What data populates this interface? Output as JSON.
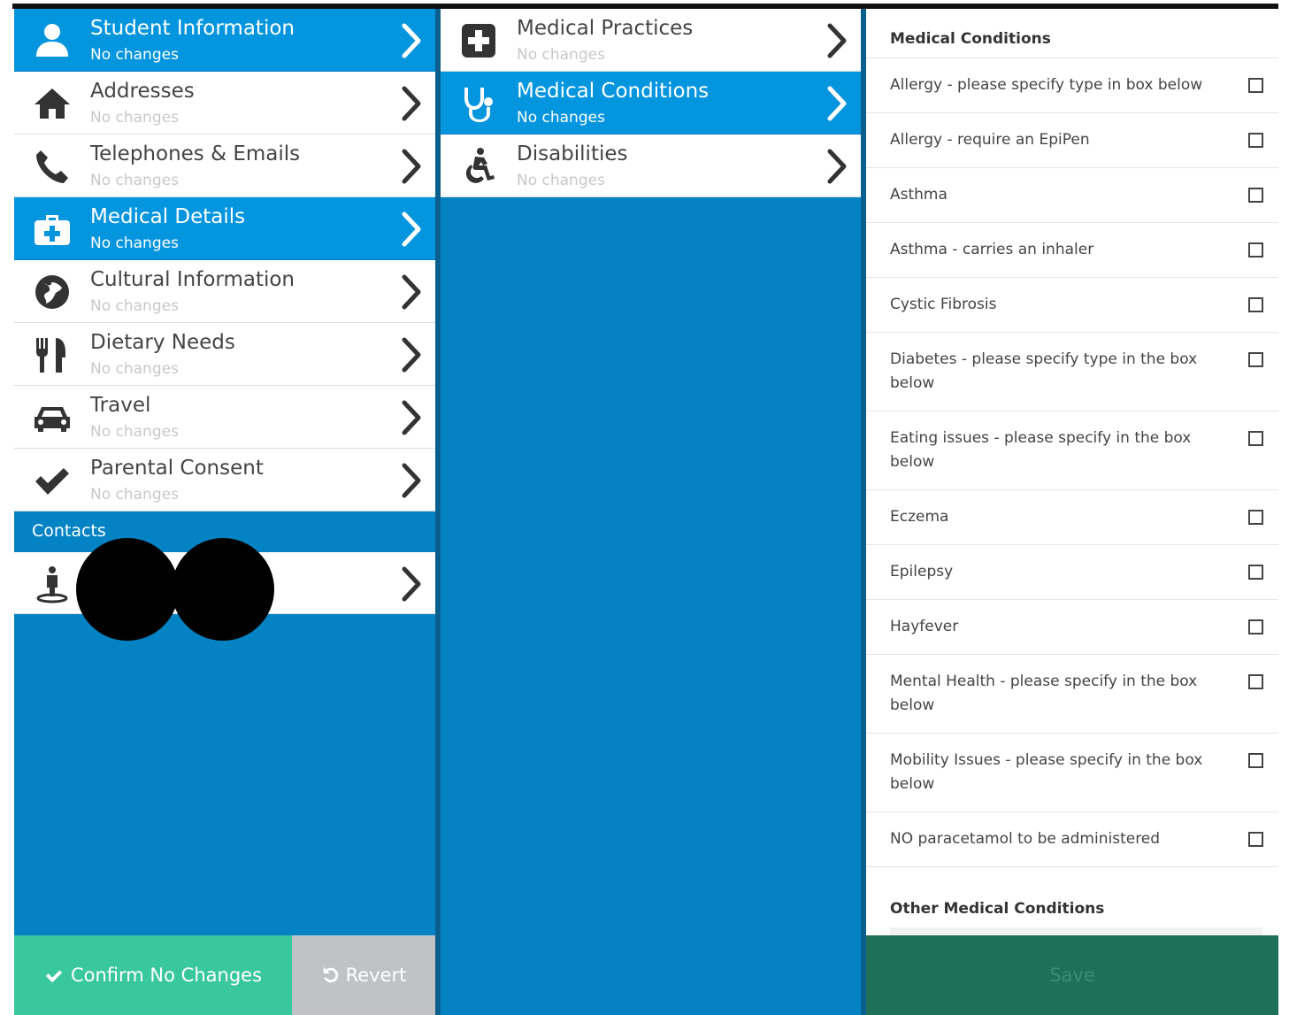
{
  "colors": {
    "accent_blue": "#0495df",
    "panel_blue": "#0483c4",
    "confirm_green": "#39c79d",
    "revert_grey": "#bfc3c6",
    "save_dark_green": "#1f7058"
  },
  "left_nav": {
    "items": [
      {
        "title": "Student Information",
        "status": "No changes",
        "icon": "user-icon"
      },
      {
        "title": "Addresses",
        "status": "No changes",
        "icon": "home-icon"
      },
      {
        "title": "Telephones & Emails",
        "status": "No changes",
        "icon": "phone-icon"
      },
      {
        "title": "Medical Details",
        "status": "No changes",
        "icon": "medkit-icon"
      },
      {
        "title": "Cultural Information",
        "status": "No changes",
        "icon": "globe-icon"
      },
      {
        "title": "Dietary Needs",
        "status": "No changes",
        "icon": "cutlery-icon"
      },
      {
        "title": "Travel",
        "status": "No changes",
        "icon": "car-icon"
      },
      {
        "title": "Parental Consent",
        "status": "No changes",
        "icon": "check-icon"
      }
    ],
    "contacts_heading": "Contacts"
  },
  "footer": {
    "confirm_label": "Confirm No Changes",
    "revert_label": "Revert"
  },
  "middle_nav": {
    "items": [
      {
        "title": "Medical Practices",
        "status": "No changes",
        "icon": "plus-square-icon"
      },
      {
        "title": "Medical Conditions",
        "status": "No changes",
        "icon": "stethoscope-icon"
      },
      {
        "title": "Disabilities",
        "status": "No changes",
        "icon": "wheelchair-icon"
      }
    ]
  },
  "conditions_form": {
    "heading": "Medical Conditions",
    "items": [
      "Allergy - please specify type in box below",
      "Allergy - require an EpiPen",
      "Asthma",
      "Asthma - carries an inhaler",
      "Cystic Fibrosis",
      "Diabetes - please specify type in the box below",
      "Eating issues - please specify in the box below",
      "Eczema",
      "Epilepsy",
      "Hayfever",
      "Mental Health - please specify in the box below",
      "Mobility Issues - please specify in the box below",
      "NO paracetamol to be administered"
    ],
    "other_heading": "Other Medical Conditions",
    "save_label": "Save"
  }
}
